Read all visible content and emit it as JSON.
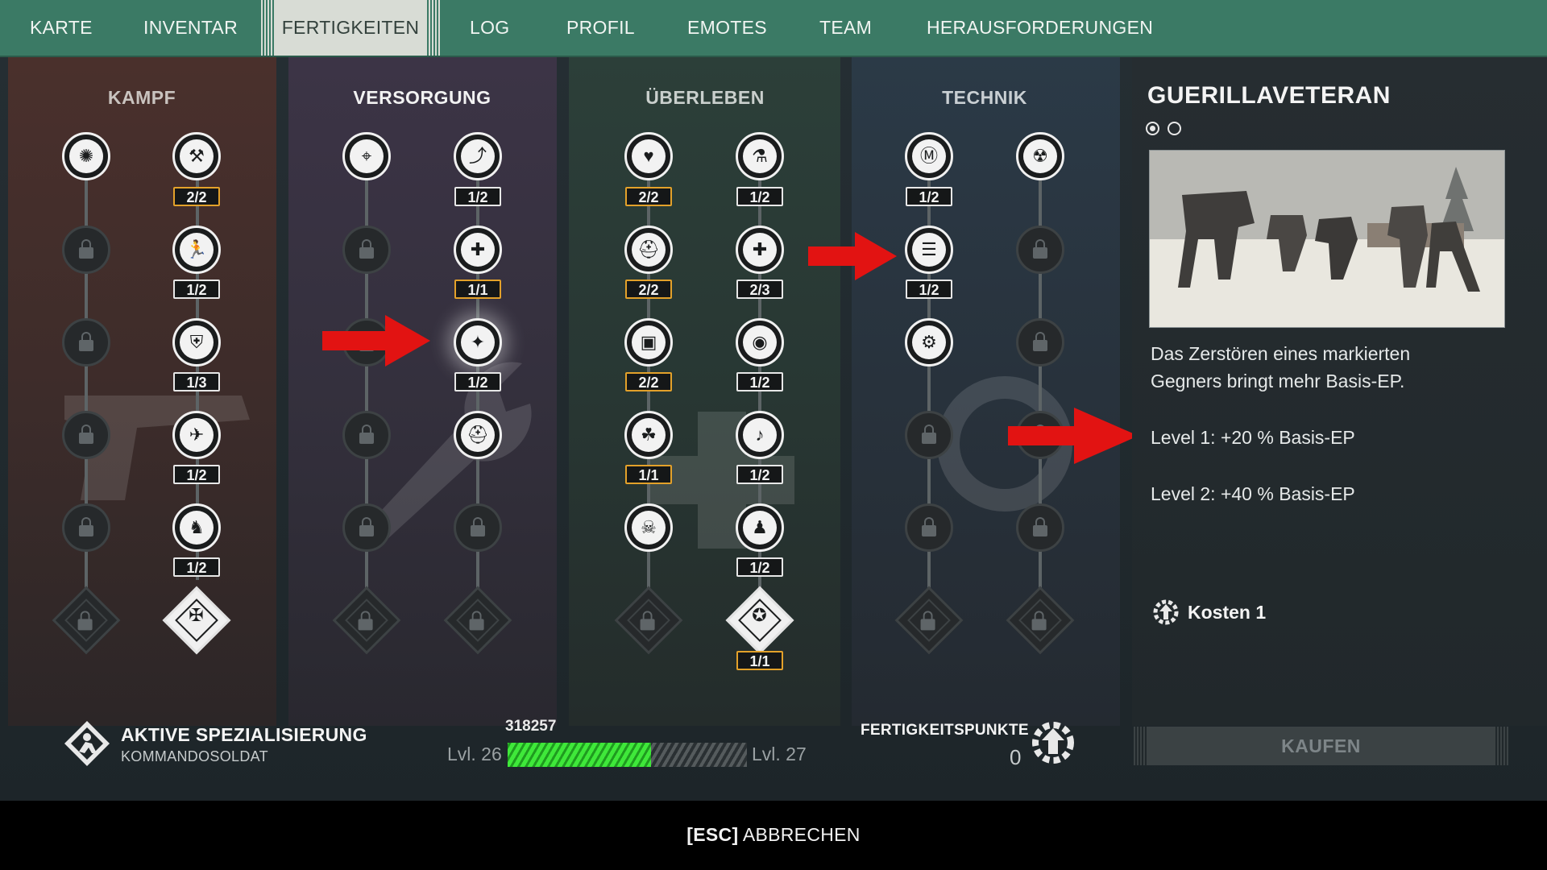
{
  "nav": {
    "tabs": [
      "KARTE",
      "INVENTAR",
      "FERTIGKEITEN",
      "LOG",
      "PROFIL",
      "EMOTES",
      "TEAM",
      "HERAUSFORDERUNGEN"
    ],
    "active": "FERTIGKEITEN"
  },
  "columns": {
    "kampf": "KAMPF",
    "versorgung": "VERSORGUNG",
    "ueberleben": "ÜBERLEBEN",
    "technik": "TECHNIK"
  },
  "badges": {
    "kampf_r1": "2/2",
    "kampf_r2": "1/2",
    "kampf_r3": "1/3",
    "kampf_r4": "1/2",
    "kampf_r5": "1/2",
    "versorgung_r1": "1/2",
    "versorgung_r2": "1/1",
    "versorgung_r3": "1/2",
    "ueberleben_a_r1": "2/2",
    "ueberleben_a_r2": "2/2",
    "ueberleben_a_r3": "2/2",
    "ueberleben_a_r4": "1/1",
    "ueberleben_b_r1": "1/2",
    "ueberleben_b_r2": "2/3",
    "ueberleben_b_r3": "1/2",
    "ueberleben_b_r4": "1/2",
    "ueberleben_b_r5": "1/2",
    "ueberleben_b_r6": "1/1",
    "technik_r1": "1/2",
    "technik_r2": "1/2"
  },
  "detail": {
    "title": "GUERILLAVETERAN",
    "description_line1": "Das Zerstören eines markierten",
    "description_line2": "Gegners bringt mehr Basis-EP.",
    "level1": "Level 1: +20 % Basis-EP",
    "level2": "Level 2: +40 % Basis-EP",
    "cost": "Kosten 1",
    "buy": "KAUFEN"
  },
  "spec": {
    "title": "AKTIVE SPEZIALISIERUNG",
    "name": "KOMMANDOSOLDAT"
  },
  "xp": {
    "value": "318257",
    "level_current": "Lvl. 26",
    "level_next": "Lvl. 27",
    "progress": 0.6
  },
  "skill_points": {
    "label": "FERTIGKEITSPUNKTE",
    "value": "0"
  },
  "footer": {
    "key": "[ESC]",
    "action": "ABBRECHEN"
  },
  "colors": {
    "nav": "#3b7a65",
    "badge_gold": "#e3a12a",
    "xp_green": "#3fe83a",
    "arrow_red": "#e21312"
  }
}
